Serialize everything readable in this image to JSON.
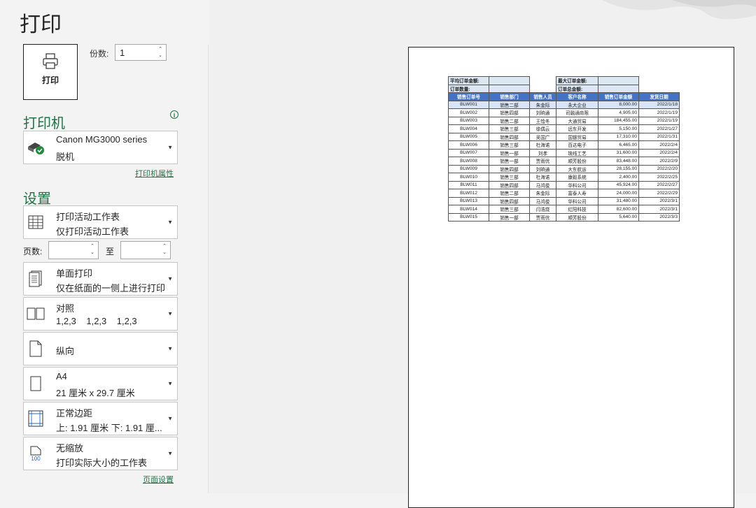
{
  "page": {
    "title": "打印"
  },
  "print": {
    "button_label": "打印",
    "copies_label": "份数:",
    "copies_value": "1"
  },
  "printer": {
    "heading": "打印机",
    "name": "Canon MG3000 series",
    "status": "脱机",
    "properties_link": "打印机属性"
  },
  "settings": {
    "heading": "设置",
    "what_to_print": {
      "title": "打印活动工作表",
      "desc": "仅打印活动工作表"
    },
    "pages_label": "页数:",
    "pages_to": "至",
    "sides": {
      "title": "单面打印",
      "desc": "仅在纸面的一侧上进行打印"
    },
    "collate": {
      "title": "对照",
      "desc": "1,2,3    1,2,3    1,2,3"
    },
    "orientation": {
      "title": "纵向"
    },
    "paper": {
      "title": "A4",
      "desc": "21 厘米 x 29.7 厘米"
    },
    "margins": {
      "title": "正常边距",
      "desc": "上: 1.91 厘米 下: 1.91 厘..."
    },
    "scaling": {
      "title": "无缩放",
      "desc": "打印实际大小的工作表",
      "icon_text": "100"
    },
    "page_setup_link": "页面设置"
  },
  "preview": {
    "summary": {
      "avg_label": "平均订单金额:",
      "max_label": "最大订单金额:",
      "count_label": "订单数量:",
      "total_label": "订单总金额:"
    },
    "headers": [
      "销售订单号",
      "销售部门",
      "销售人员",
      "客户名称",
      "销售订单金额",
      "发货日期"
    ],
    "rows": [
      [
        "BLW001",
        "销售二部",
        "朱金际",
        "永大企业",
        "8,000.00",
        "2022/1/18"
      ],
      [
        "BLW002",
        "销售四部",
        "刘晌通",
        "司融通商限",
        "4,905.00",
        "2022/1/19"
      ],
      [
        "BLW003",
        "销售二部",
        "王恰冬",
        "大通贸易",
        "184,455.00",
        "2022/1/19"
      ],
      [
        "BLW004",
        "销售三部",
        "徐偶云",
        "远东开发",
        "5,150.00",
        "2022/1/27"
      ],
      [
        "BLW005",
        "销售四部",
        "吴国广",
        "国银贸易",
        "17,310.00",
        "2022/1/31"
      ],
      [
        "BLW006",
        "销售三部",
        "杜海诺",
        "百达电子",
        "6,465.00",
        "2022/2/4"
      ],
      [
        "BLW007",
        "销售一部",
        "刘孝",
        "琉线工艺",
        "31,600.00",
        "2022/2/4"
      ],
      [
        "BLW008",
        "销售一部",
        "贾雨优",
        "顺芳股份",
        "83,448.00",
        "2022/2/9"
      ],
      [
        "BLW009",
        "销售四部",
        "刘晌通",
        "大东航运",
        "28,155.00",
        "2022/2/20"
      ],
      [
        "BLW010",
        "销售三部",
        "杜海诺",
        "康毅系统",
        "2,400.00",
        "2022/2/25"
      ],
      [
        "BLW011",
        "销售四部",
        "马鸿俊",
        "华科公司",
        "45,924.00",
        "2022/2/27"
      ],
      [
        "BLW012",
        "销售二部",
        "朱金际",
        "富泰人寿",
        "24,000.00",
        "2022/2/29"
      ],
      [
        "BLW013",
        "销售四部",
        "马鸿俊",
        "华科公司",
        "31,480.00",
        "2022/3/1"
      ],
      [
        "BLW014",
        "销售三部",
        "闫浩烧",
        "红阳科技",
        "82,600.00",
        "2022/3/1"
      ],
      [
        "BLW015",
        "销售一部",
        "贾雨优",
        "顺芳股份",
        "5,640.00",
        "2022/3/3"
      ]
    ]
  },
  "icons": {
    "print": "printer-icon",
    "printer_status": "printer-ready-icon",
    "sheet": "worksheet-grid-icon",
    "sides": "single-sided-icon",
    "collate": "collate-icon",
    "orientation": "portrait-icon",
    "paper": "paper-size-icon",
    "margins": "margins-icon",
    "scaling": "scaling-icon",
    "info": "info-icon"
  },
  "colors": {
    "accent": "#217346",
    "table_header": "#4472c4",
    "summary_fill": "#dbe7f3"
  }
}
